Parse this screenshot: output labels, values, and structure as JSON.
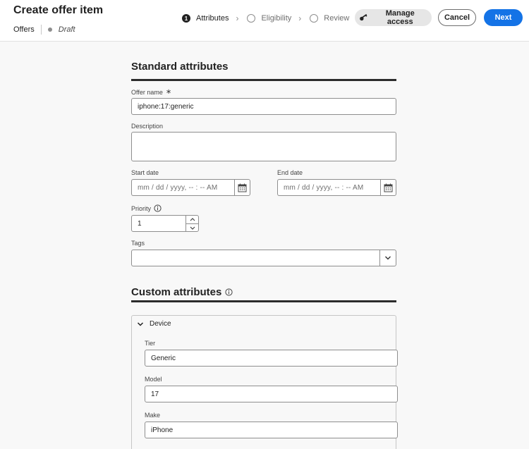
{
  "header": {
    "title": "Create offer item",
    "breadcrumb": {
      "root": "Offers",
      "status": "Draft"
    },
    "steps": [
      {
        "number": "1",
        "label": "Attributes",
        "state": "active"
      },
      {
        "label": "Eligibility",
        "state": "pending"
      },
      {
        "label": "Review",
        "state": "pending"
      }
    ],
    "buttons": {
      "manage_access": "Manage access",
      "cancel": "Cancel",
      "next": "Next"
    }
  },
  "standard": {
    "title": "Standard attributes",
    "offer_name": {
      "label": "Offer name",
      "required_mark": "∗",
      "value": "iphone:17:generic"
    },
    "description": {
      "label": "Description",
      "value": ""
    },
    "start_date": {
      "label": "Start date",
      "placeholder": "mm / dd / yyyy,  -- : --  AM"
    },
    "end_date": {
      "label": "End date",
      "placeholder": "mm / dd / yyyy,  -- : --  AM"
    },
    "priority": {
      "label": "Priority",
      "value": "1"
    },
    "tags": {
      "label": "Tags",
      "value": ""
    }
  },
  "custom": {
    "title": "Custom attributes",
    "group": {
      "name": "Device",
      "fields": [
        {
          "label": "Tier",
          "value": "Generic"
        },
        {
          "label": "Model",
          "value": "17"
        },
        {
          "label": "Make",
          "value": "iPhone"
        }
      ]
    }
  },
  "colors": {
    "accent": "#1473e6",
    "text": "#222222",
    "background": "#f8f8f8"
  }
}
